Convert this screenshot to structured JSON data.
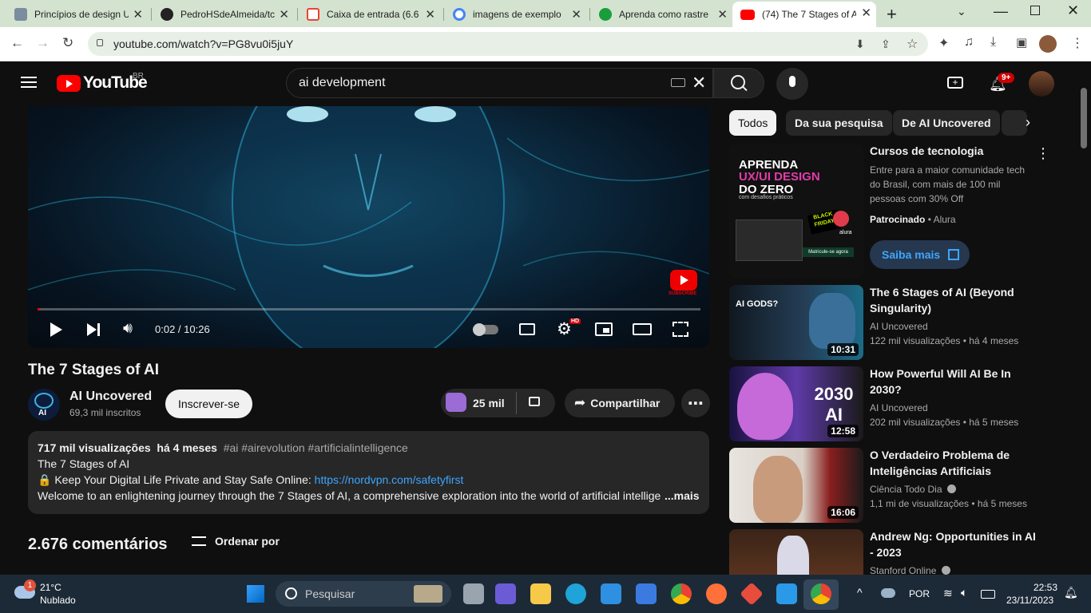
{
  "browser": {
    "tabs": [
      {
        "title": "Princípios de design U",
        "color": "#7a8c9e"
      },
      {
        "title": "PedroHSdeAlmeida/tc",
        "color": "#222222"
      },
      {
        "title": "Caixa de entrada (6.6",
        "color": "#ea4335"
      },
      {
        "title": "imagens de exemplo",
        "color": "#4285f4"
      },
      {
        "title": "Aprenda como rastre",
        "color": "#1a9e3c"
      },
      {
        "title": "(74) The 7 Stages of A",
        "color": "#ff0000"
      }
    ],
    "url": "youtube.com/watch?v=PG8vu0i5juY"
  },
  "youtube": {
    "logo_text": "YouTube",
    "region": "BR",
    "search_query": "ai development",
    "notif_badge": "9+"
  },
  "player": {
    "time": "0:02 / 10:26",
    "hd_badge": "HD",
    "subscribe_watermark": "SUBSCRIBE",
    "progress_fraction": 0.003
  },
  "video": {
    "title": "The 7 Stages of AI",
    "channel": "AI Uncovered",
    "channel_avatar_text": "AI",
    "subscribers": "69,3 mil inscritos",
    "subscribe_label": "Inscrever-se",
    "likes": "25 mil",
    "share_label": "Compartilhar"
  },
  "description": {
    "views": "717 mil visualizações",
    "age": "há 4 meses",
    "hashtags": "#ai #airevolution #artificialintelligence",
    "line1": "The 7 Stages of AI",
    "line2_lock": "🔒",
    "line2": "Keep Your Digital Life Private and Stay Safe Online:",
    "line2_link": "https://nordvpn.com/safetyfirst",
    "line3": "Welcome to an enlightening journey through the 7 Stages of AI, a comprehensive exploration into the world of artificial intellige",
    "more": "...mais"
  },
  "comments": {
    "count": "2.676 comentários",
    "sort_label": "Ordenar por"
  },
  "chips": [
    "Todos",
    "Da sua pesquisa",
    "De AI Uncovered"
  ],
  "ad": {
    "title": "Cursos de tecnologia",
    "body": "Entre para a maior comunidade tech do Brasil, com mais de 100 mil pessoas com 30% Off",
    "sponsored": "Patrocinado",
    "advertiser": "Alura",
    "cta": "Saiba mais",
    "thumb_line1": "APRENDA",
    "thumb_line2": "UX/UI DESIGN",
    "thumb_line3": "DO ZERO",
    "thumb_line4": "com desafios práticos",
    "thumb_badge": "BLACK FRIDAY",
    "thumb_brand": "alura",
    "thumb_cta": "Matricule-se agora"
  },
  "recommendations": [
    {
      "title": "The 6 Stages of AI (Beyond Singularity)",
      "channel": "AI Uncovered",
      "meta": "122 mil visualizações  •  há 4 meses",
      "duration": "10:31",
      "thumb_text": "AI GODS?",
      "verified": false
    },
    {
      "title": "How Powerful Will AI Be In 2030?",
      "channel": "AI Uncovered",
      "meta": "202 mil visualizações  •  há 5 meses",
      "duration": "12:58",
      "thumb_text": "2030 AI",
      "verified": false
    },
    {
      "title": "O Verdadeiro Problema de Inteligências Artificiais",
      "channel": "Ciência Todo Dia",
      "meta": "1,1 mi de visualizações  •  há 5 meses",
      "duration": "16:06",
      "thumb_text": "",
      "verified": true
    },
    {
      "title": "Andrew Ng: Opportunities in AI - 2023",
      "channel": "Stanford Online",
      "meta": "",
      "duration": "",
      "thumb_text": "",
      "verified": true
    }
  ],
  "taskbar": {
    "weather_temp": "21°C",
    "weather_desc": "Nublado",
    "weather_badge": "1",
    "search_label": "Pesquisar",
    "lang": "POR",
    "time": "22:53",
    "date": "23/11/2023"
  }
}
